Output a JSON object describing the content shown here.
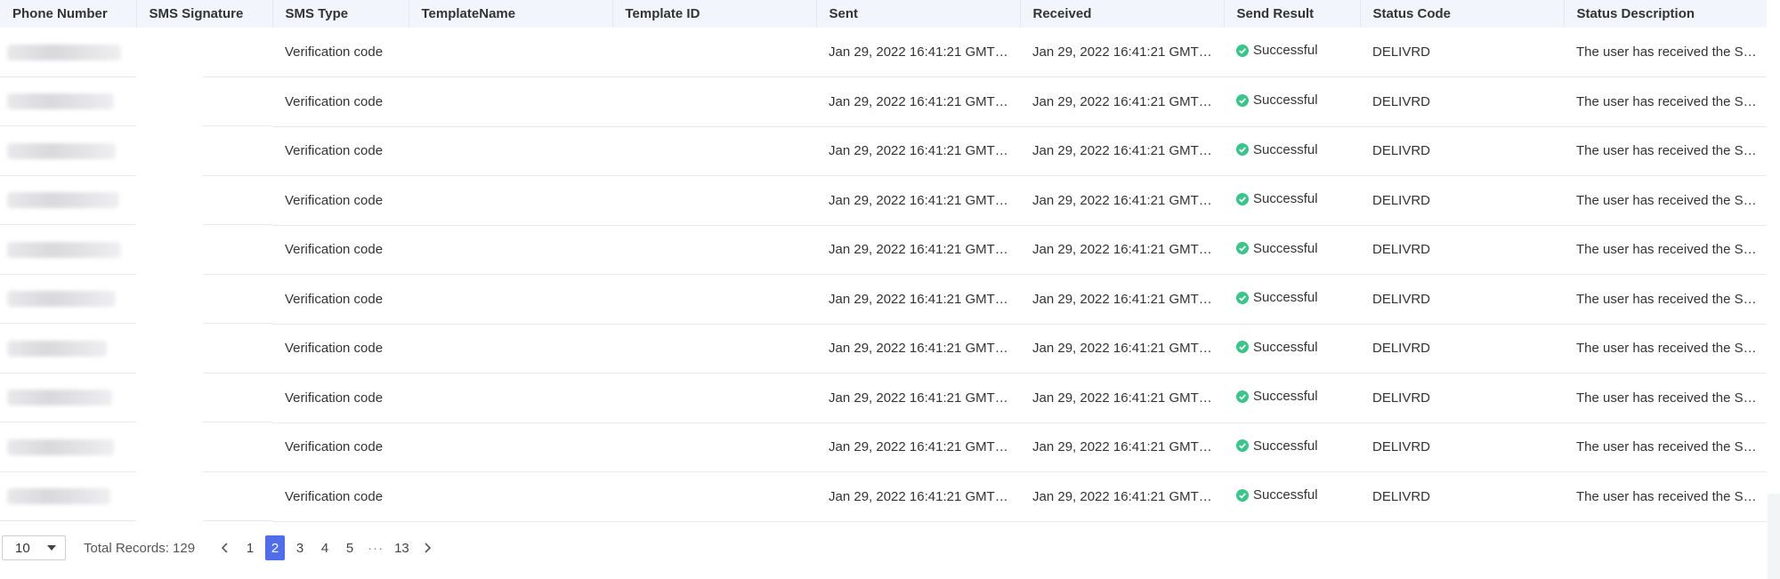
{
  "table": {
    "headers": [
      "Phone Number",
      "SMS Signature",
      "SMS Type",
      "TemplateName",
      "Template ID",
      "Sent",
      "Received",
      "Send Result",
      "Status Code",
      "Status Description"
    ],
    "rows": [
      {
        "sms_type": "Verification code",
        "template_name": "",
        "template_id": "",
        "sent": "Jan 29, 2022 16:41:21 GMT…",
        "received": "Jan 29, 2022 16:41:21 GMT…",
        "send_result": "Successful",
        "status_code": "DELIVRD",
        "status_description": "The user has received the S…"
      },
      {
        "sms_type": "Verification code",
        "template_name": "",
        "template_id": "",
        "sent": "Jan 29, 2022 16:41:21 GMT…",
        "received": "Jan 29, 2022 16:41:21 GMT…",
        "send_result": "Successful",
        "status_code": "DELIVRD",
        "status_description": "The user has received the S…"
      },
      {
        "sms_type": "Verification code",
        "template_name": "",
        "template_id": "",
        "sent": "Jan 29, 2022 16:41:21 GMT…",
        "received": "Jan 29, 2022 16:41:21 GMT…",
        "send_result": "Successful",
        "status_code": "DELIVRD",
        "status_description": "The user has received the S…"
      },
      {
        "sms_type": "Verification code",
        "template_name": "",
        "template_id": "",
        "sent": "Jan 29, 2022 16:41:21 GMT…",
        "received": "Jan 29, 2022 16:41:21 GMT…",
        "send_result": "Successful",
        "status_code": "DELIVRD",
        "status_description": "The user has received the S…"
      },
      {
        "sms_type": "Verification code",
        "template_name": "",
        "template_id": "",
        "sent": "Jan 29, 2022 16:41:21 GMT…",
        "received": "Jan 29, 2022 16:41:21 GMT…",
        "send_result": "Successful",
        "status_code": "DELIVRD",
        "status_description": "The user has received the S…"
      },
      {
        "sms_type": "Verification code",
        "template_name": "",
        "template_id": "",
        "sent": "Jan 29, 2022 16:41:21 GMT…",
        "received": "Jan 29, 2022 16:41:21 GMT…",
        "send_result": "Successful",
        "status_code": "DELIVRD",
        "status_description": "The user has received the S…"
      },
      {
        "sms_type": "Verification code",
        "template_name": "",
        "template_id": "",
        "sent": "Jan 29, 2022 16:41:21 GMT…",
        "received": "Jan 29, 2022 16:41:21 GMT…",
        "send_result": "Successful",
        "status_code": "DELIVRD",
        "status_description": "The user has received the S…"
      },
      {
        "sms_type": "Verification code",
        "template_name": "",
        "template_id": "",
        "sent": "Jan 29, 2022 16:41:21 GMT…",
        "received": "Jan 29, 2022 16:41:21 GMT…",
        "send_result": "Successful",
        "status_code": "DELIVRD",
        "status_description": "The user has received the S…"
      },
      {
        "sms_type": "Verification code",
        "template_name": "",
        "template_id": "",
        "sent": "Jan 29, 2022 16:41:21 GMT…",
        "received": "Jan 29, 2022 16:41:21 GMT…",
        "send_result": "Successful",
        "status_code": "DELIVRD",
        "status_description": "The user has received the S…"
      },
      {
        "sms_type": "Verification code",
        "template_name": "",
        "template_id": "",
        "sent": "Jan 29, 2022 16:41:21 GMT…",
        "received": "Jan 29, 2022 16:41:21 GMT…",
        "send_result": "Successful",
        "status_code": "DELIVRD",
        "status_description": "The user has received the S…"
      }
    ]
  },
  "pagination": {
    "page_size": "10",
    "total_label": "Total Records: 129",
    "pages": [
      "1",
      "2",
      "3",
      "4",
      "5",
      "···",
      "13"
    ],
    "current": "2"
  },
  "icons": {
    "success": "check-circle-icon",
    "prev": "chevron-left-icon",
    "next": "chevron-right-icon",
    "dropdown": "caret-down-icon"
  },
  "colors": {
    "header_bg": "#f2f5fc",
    "success": "#3bc58a",
    "active_page": "#4f6ee8"
  }
}
